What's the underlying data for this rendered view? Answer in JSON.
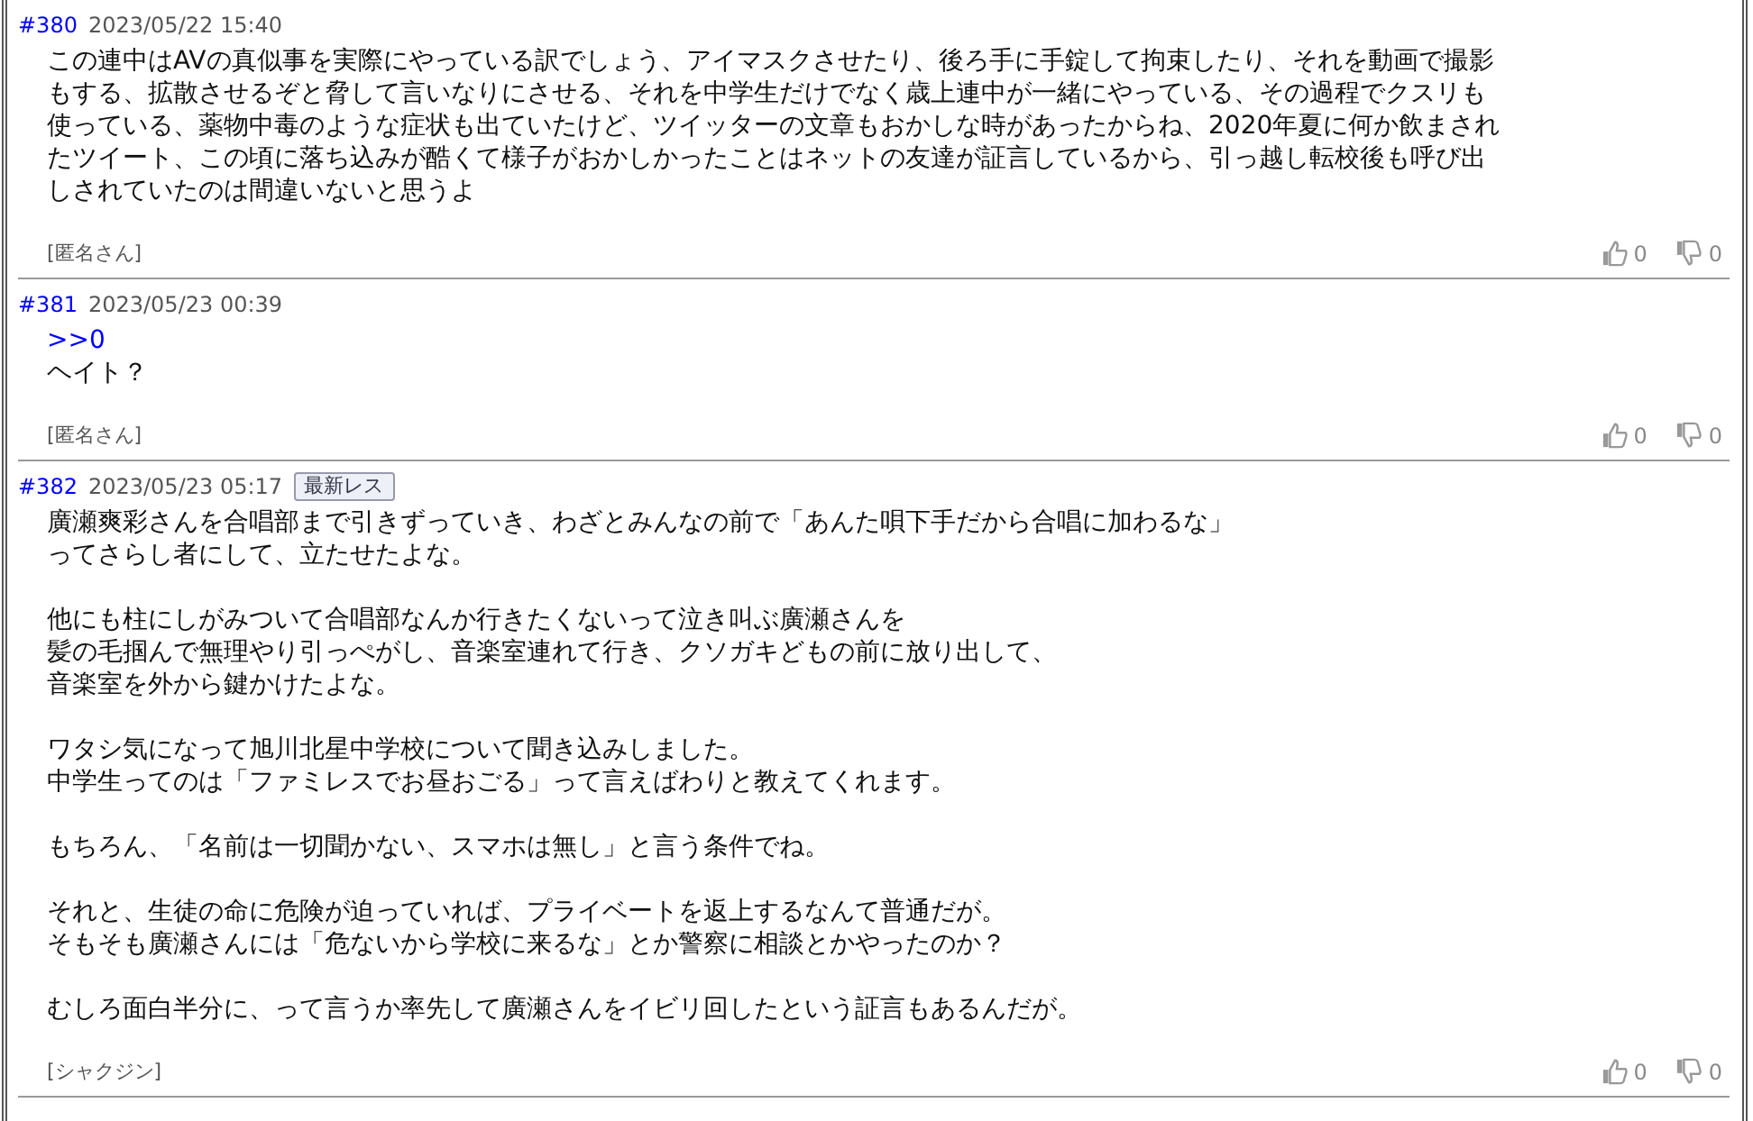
{
  "posts": [
    {
      "number": "#380",
      "date": "2023/05/22 15:40",
      "paragraphs": [
        [
          {
            "kind": "text",
            "text": "この連中はAVの真似事を実際にやっている訳でしょう、アイマスクさせたり、後ろ手に手錠して拘束したり、それを動画で撮影もする、拡散させるぞと脅して言いなりにさせる、それを中学生だけでなく歳上連中が一緒にやっている、その過程でクスリも使っている、薬物中毒のような症状も出ていたけど、ツイッターの文章もおかしな時があったからね、2020年夏に何か飲まされたツイート、この頃に落ち込みが酷くて様子がおかしかったことはネットの友達が証言しているから、引っ越し転校後も呼び出しされていたのは間違いないと思うよ"
          }
        ]
      ],
      "author": "[匿名さん]",
      "likes": "0",
      "dislikes": "0"
    },
    {
      "number": "#381",
      "date": "2023/05/23 00:39",
      "paragraphs": [
        [
          {
            "kind": "link",
            "text": ">>0"
          },
          {
            "kind": "text",
            "text": "ヘイト？"
          }
        ]
      ],
      "author": "[匿名さん]",
      "likes": "0",
      "dislikes": "0"
    },
    {
      "number": "#382",
      "date": "2023/05/23 05:17",
      "badge": "最新レス",
      "paragraphs": [
        [
          {
            "kind": "text",
            "text": "廣瀬爽彩さんを合唱部まで引きずっていき、わざとみんなの前で「あんた唄下手だから合唱に加わるな」"
          },
          {
            "kind": "text",
            "text": "ってさらし者にして、立たせたよな。"
          }
        ],
        [
          {
            "kind": "text",
            "text": "他にも柱にしがみついて合唱部なんか行きたくないって泣き叫ぶ廣瀬さんを"
          },
          {
            "kind": "text",
            "text": "髪の毛掴んで無理やり引っぺがし、音楽室連れて行き、クソガキどもの前に放り出して、"
          },
          {
            "kind": "text",
            "text": "音楽室を外から鍵かけたよな。"
          }
        ],
        [
          {
            "kind": "text",
            "text": "ワタシ気になって旭川北星中学校について聞き込みしました。"
          },
          {
            "kind": "text",
            "text": "中学生ってのは「ファミレスでお昼おごる」って言えばわりと教えてくれます。"
          }
        ],
        [
          {
            "kind": "text",
            "text": "もちろん、「名前は一切聞かない、スマホは無し」と言う条件でね。"
          }
        ],
        [
          {
            "kind": "text",
            "text": "それと、生徒の命に危険が迫っていれば、プライベートを返上するなんて普通だが。"
          },
          {
            "kind": "text",
            "text": "そもそも廣瀬さんには「危ないから学校に来るな」とか警察に相談とかやったのか？"
          }
        ],
        [
          {
            "kind": "text",
            "text": "むしろ面白半分に、って言うか率先して廣瀬さんをイビリ回したという証言もあるんだが。"
          }
        ]
      ],
      "author": "[シャクジン]",
      "likes": "0",
      "dislikes": "0"
    }
  ]
}
